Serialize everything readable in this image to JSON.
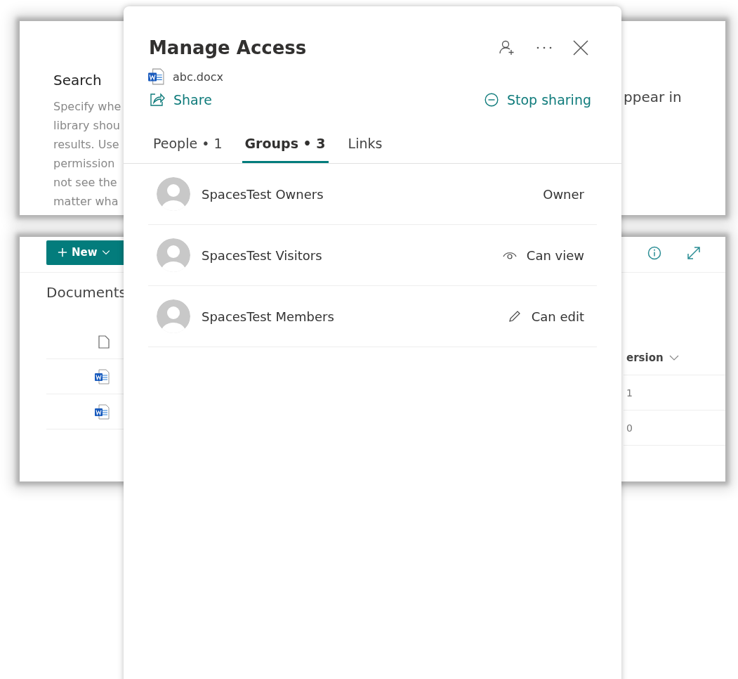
{
  "search_card": {
    "title": "Search",
    "description": "Specify whe\nlibrary shou\nresults. Use\npermission\nnot see the\nmatter wha",
    "right_text": "ppear in"
  },
  "library_card": {
    "new_button": "New",
    "title": "Documents",
    "column_header": "ersion",
    "rows": [
      {
        "cell": "1"
      },
      {
        "cell": "0"
      }
    ]
  },
  "dialog": {
    "title": "Manage Access",
    "file_name": "abc.docx",
    "share": "Share",
    "stop_sharing": "Stop sharing",
    "tabs": [
      {
        "label": "People • 1",
        "selected": false
      },
      {
        "label": "Groups • 3",
        "selected": true
      },
      {
        "label": "Links",
        "selected": false
      }
    ],
    "groups": [
      {
        "name": "SpacesTest Owners",
        "role": "Owner",
        "kind": "owner"
      },
      {
        "name": "SpacesTest Visitors",
        "role": "Can view",
        "kind": "view"
      },
      {
        "name": "SpacesTest Members",
        "role": "Can edit",
        "kind": "edit"
      }
    ]
  }
}
